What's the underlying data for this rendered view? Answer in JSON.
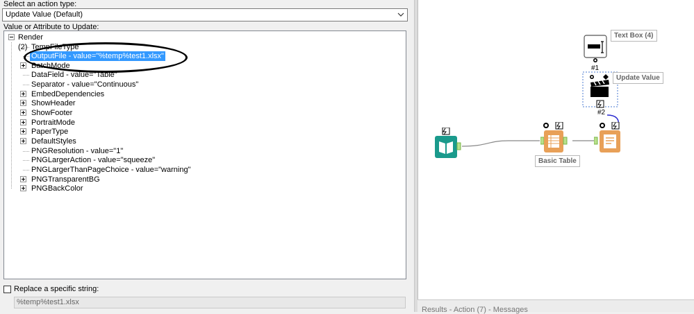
{
  "left": {
    "action_type_label": "Select an action type:",
    "action_type_value": "Update Value (Default)",
    "value_label": "Value or Attribute to Update:",
    "tree": {
      "root": "Render (2)",
      "items": [
        {
          "text": "TempFileType",
          "expandable": false
        },
        {
          "text": "OutputFile - value=\"%temp%test1.xlsx\"",
          "expandable": false,
          "selected": true
        },
        {
          "text": "BatchMode",
          "expandable": true
        },
        {
          "text": "DataField - value=\"Table\"",
          "expandable": false
        },
        {
          "text": "Separator - value=\"Continuous\"",
          "expandable": false
        },
        {
          "text": "EmbedDependencies",
          "expandable": true
        },
        {
          "text": "ShowHeader",
          "expandable": true
        },
        {
          "text": "ShowFooter",
          "expandable": true
        },
        {
          "text": "PortraitMode",
          "expandable": true
        },
        {
          "text": "PaperType",
          "expandable": true
        },
        {
          "text": "DefaultStyles",
          "expandable": true
        },
        {
          "text": "PNGResolution - value=\"1\"",
          "expandable": false
        },
        {
          "text": "PNGLargerAction - value=\"squeeze\"",
          "expandable": false
        },
        {
          "text": "PNGLargerThanPageChoice - value=\"warning\"",
          "expandable": false
        },
        {
          "text": "PNGTransparentBG",
          "expandable": true
        },
        {
          "text": "PNGBackColor",
          "expandable": true
        }
      ]
    },
    "replace_label": "Replace a specific string:",
    "replace_value": "%temp%test1.xlsx"
  },
  "canvas": {
    "text_box_label": "Text Box (4)",
    "update_value_label": "Update Value",
    "basic_table_label": "Basic Table",
    "conn1": "#1",
    "conn2": "#2"
  },
  "results_bar": "Results - Action (7) - Messages",
  "colors": {
    "selection": "#3399ff",
    "reporting_orange": "#e8a058",
    "input_teal": "#1a9a8c",
    "wire_green": "#7ab648",
    "control_blue": "#2a2acf"
  },
  "icons": [
    "chevron-down-icon",
    "book-input-icon",
    "table-tool-icon",
    "render-tool-icon",
    "textbox-tool-icon",
    "clapperboard-icon",
    "lightning-icon",
    "q-badge-icon"
  ]
}
